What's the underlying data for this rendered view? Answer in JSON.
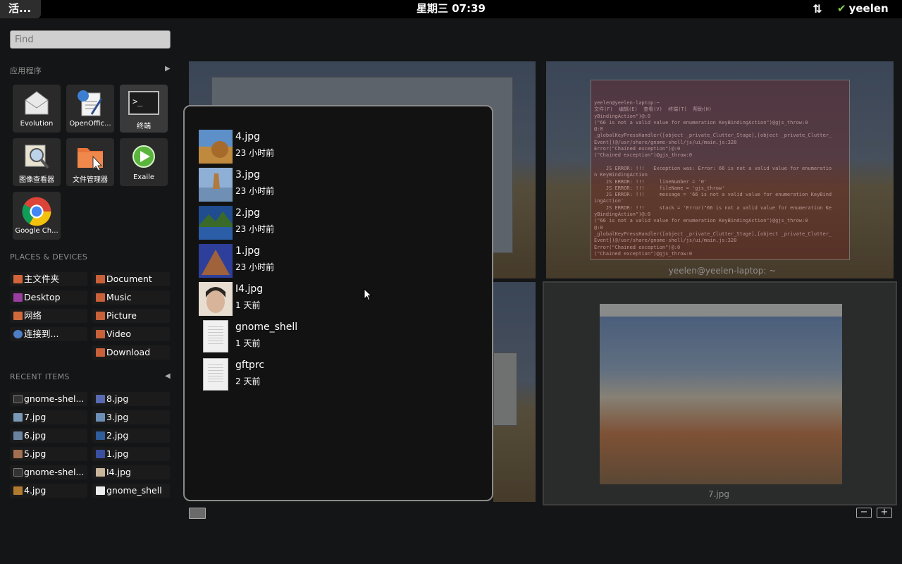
{
  "topbar": {
    "activities": "活...",
    "clock": "星期三 07:39",
    "user": "yeelen",
    "icons": [
      "network-arrows-icon",
      "status-check-icon"
    ]
  },
  "search": {
    "placeholder": "Find"
  },
  "applications": {
    "title": "应用程序",
    "items": [
      {
        "label": "Evolution",
        "icon": "evolution-icon"
      },
      {
        "label": "OpenOffic...",
        "icon": "openoffice-icon"
      },
      {
        "label": "终端",
        "icon": "terminal-icon"
      },
      {
        "label": "图像查看器",
        "icon": "image-viewer-icon"
      },
      {
        "label": "文件管理器",
        "icon": "file-manager-icon"
      },
      {
        "label": "Exaile",
        "icon": "exaile-icon"
      },
      {
        "label": "Google Ch...",
        "icon": "chrome-icon"
      }
    ]
  },
  "places": {
    "title": "PLACES & DEVICES",
    "left": [
      "主文件夹",
      "Desktop",
      "网络",
      "连接到..."
    ],
    "right": [
      "Document",
      "Music",
      "Picture",
      "Video",
      "Download"
    ]
  },
  "recent": {
    "title": "RECENT ITEMS",
    "left": [
      "gnome-shel...",
      "7.jpg",
      "6.jpg",
      "5.jpg",
      "gnome-shel...",
      "4.jpg"
    ],
    "right": [
      "8.jpg",
      "3.jpg",
      "2.jpg",
      "1.jpg",
      "I4.jpg",
      "gnome_shell"
    ]
  },
  "popup": {
    "items": [
      {
        "name": "4.jpg",
        "time": "23 小时前",
        "kind": "image",
        "color": "#b27a2e"
      },
      {
        "name": "3.jpg",
        "time": "23 小时前",
        "kind": "image",
        "color": "#6d8fb7"
      },
      {
        "name": "2.jpg",
        "time": "23 小时前",
        "kind": "image",
        "color": "#2f5c9a"
      },
      {
        "name": "1.jpg",
        "time": "23 小时前",
        "kind": "image",
        "color": "#3a4fa0"
      },
      {
        "name": "I4.jpg",
        "time": "1 天前",
        "kind": "image",
        "color": "#c9b59b"
      },
      {
        "name": "gnome_shell",
        "time": "1 天前",
        "kind": "document"
      },
      {
        "name": "gftprc",
        "time": "2 天前",
        "kind": "document"
      }
    ]
  },
  "workspace": {
    "terminal_caption": "yeelen@yeelen-laptop: ~",
    "photo_caption": "7.jpg",
    "terminal_text": "yeelen@yeelen-laptop:~\n文件(F)  编辑(E)  查看(V)  终端(T)  帮助(H)\nyBindingAction\")@:0\n(\"66 is not a valid value for enumeration KeyBindingAction\")@gjs_throw:0\n@:0\n_globalKeyPressHandler([object _private_Clutter_Stage],[object _private_Clutter_\nEvent])@/usr/share/gnome-shell/js/ui/main.js:328\nError(\"Chained exception\")@:0\n(\"Chained exception\")@gjs_throw:0\n\n    JS ERROR: !!!   Exception was: Error: 66 is not a valid value for enumeratio\nn KeyBindingAction\n    JS ERROR: !!!     lineNumber = '0'\n    JS ERROR: !!!     fileName = 'gjs_throw'\n    JS ERROR: !!!     message = '66 is not a valid value for enumeration KeyBind\ningAction'\n    JS ERROR: !!!     stack = 'Error(\"66 is not a valid value for enumeration Ke\nyBindingAction\")@:0\n(\"66 is not a valid value for enumeration KeyBindingAction\")@gjs_throw:0\n@:0\n_globalKeyPressHandler([object _private_Clutter_Stage],[object _private_Clutter_\nEvent])@/usr/share/gnome-shell/js/ui/main.js:328\nError(\"Chained exception\")@:0\n(\"Chained exception\")@gjs_throw:0",
    "zoom_out": "−",
    "zoom_in": "+"
  }
}
